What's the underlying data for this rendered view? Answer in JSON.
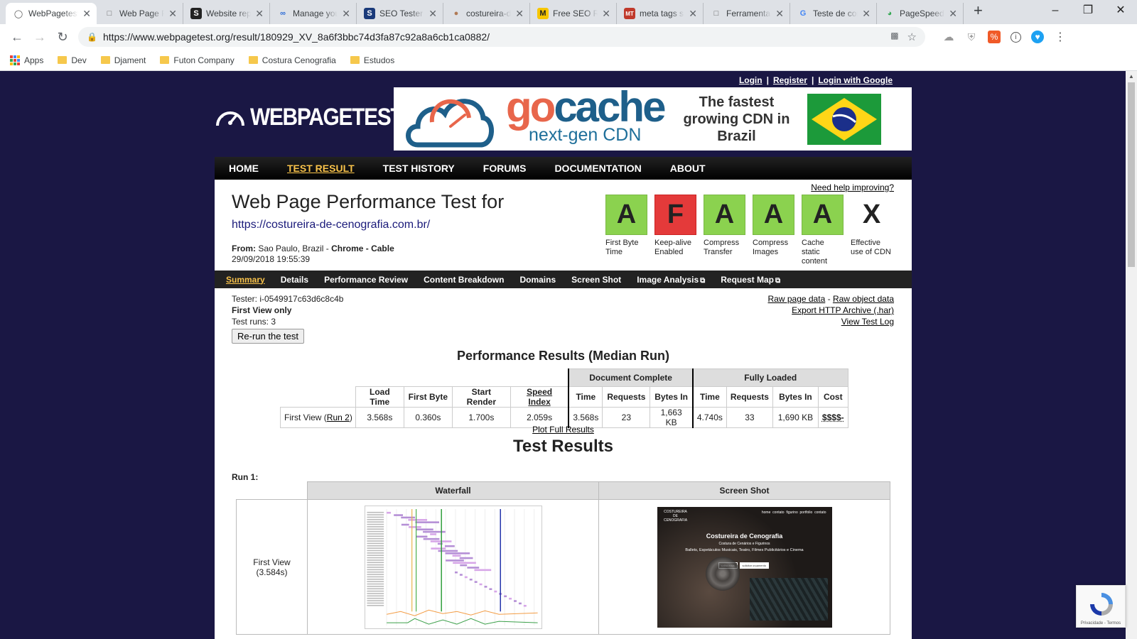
{
  "browser": {
    "tabs": [
      {
        "label": "WebPagetest",
        "icon": "speedometer",
        "active": true
      },
      {
        "label": "Web Page Performance",
        "icon": "page"
      },
      {
        "label": "Website report",
        "icon": "s-logo"
      },
      {
        "label": "Manage your",
        "icon": "infinity"
      },
      {
        "label": "SEO Tester",
        "icon": "seo"
      },
      {
        "label": "costureira-de",
        "icon": "avatar"
      },
      {
        "label": "Free SEO Report",
        "icon": "mo"
      },
      {
        "label": "meta tags seo",
        "icon": "mt"
      },
      {
        "label": "Ferramenta",
        "icon": "page"
      },
      {
        "label": "Teste de compressão",
        "icon": "g-logo"
      },
      {
        "label": "PageSpeed",
        "icon": "pagespeed"
      }
    ],
    "url": "https://www.webpagetest.org/result/180929_XV_8a6f3bbc74d3fa87c92a8a6cb1ca0882/",
    "bookmarks": [
      "Apps",
      "Dev",
      "Djament",
      "Futon Company",
      "Costura Cenografia",
      "Estudos"
    ]
  },
  "account_links": {
    "login": "Login",
    "register": "Register",
    "google": "Login with Google",
    "sep": "|"
  },
  "logo_text": "WEBPAGETEST",
  "banner": {
    "brand_part1": "go",
    "brand_part2": "cache",
    "tagline": "next-gen CDN",
    "slogan": "The fastest growing CDN in Brazil"
  },
  "main_nav": [
    {
      "label": "HOME"
    },
    {
      "label": "TEST RESULT",
      "active": true
    },
    {
      "label": "TEST HISTORY"
    },
    {
      "label": "FORUMS"
    },
    {
      "label": "DOCUMENTATION"
    },
    {
      "label": "ABOUT"
    }
  ],
  "header": {
    "title": "Web Page Performance Test for",
    "url": "https://costureira-de-cenografia.com.br/",
    "from_label": "From:",
    "location": "Sao Paulo, Brazil",
    "browser_conn": "Chrome - Cable",
    "datetime": "29/09/2018 19:55:39",
    "help_link": "Need help improving?"
  },
  "grades": [
    {
      "grade": "A",
      "label": "First Byte Time",
      "status": "good"
    },
    {
      "grade": "F",
      "label": "Keep-alive Enabled",
      "status": "bad"
    },
    {
      "grade": "A",
      "label": "Compress Transfer",
      "status": "good"
    },
    {
      "grade": "A",
      "label": "Compress Images",
      "status": "good"
    },
    {
      "grade": "A",
      "label": "Cache static content",
      "status": "good"
    },
    {
      "grade": "X",
      "label": "Effective use of CDN",
      "status": "none"
    }
  ],
  "sub_nav": [
    {
      "label": "Summary",
      "active": true
    },
    {
      "label": "Details"
    },
    {
      "label": "Performance Review"
    },
    {
      "label": "Content Breakdown"
    },
    {
      "label": "Domains"
    },
    {
      "label": "Screen Shot"
    },
    {
      "label": "Image Analysis",
      "external": true
    },
    {
      "label": "Request Map",
      "external": true
    }
  ],
  "test_info": {
    "tester": "Tester: i-0549917c63d6c8c4b",
    "view": "First View only",
    "runs": "Test runs: 3",
    "rerun_button": "Re-run the test"
  },
  "raw_links": {
    "raw_page": "Raw page data",
    "dash": "-",
    "raw_object": "Raw object data",
    "har": "Export HTTP Archive (.har)",
    "log": "View Test Log"
  },
  "perf_results": {
    "heading": "Performance Results (Median Run)",
    "group_headers": [
      "Document Complete",
      "Fully Loaded"
    ],
    "columns": [
      "Load Time",
      "First Byte",
      "Start Render",
      "Speed Index",
      "Time",
      "Requests",
      "Bytes In",
      "Time",
      "Requests",
      "Bytes In",
      "Cost"
    ],
    "row_label_prefix": "First View (",
    "row_label_link": "Run 2",
    "row_label_suffix": ")",
    "values": [
      "3.568s",
      "0.360s",
      "1.700s",
      "2.059s",
      "3.568s",
      "23",
      "1,663 KB",
      "4.740s",
      "33",
      "1,690 KB",
      "$$$$-"
    ]
  },
  "plot_link": "Plot Full Results",
  "test_results": {
    "heading": "Test Results",
    "run_label": "Run 1:",
    "col_headers": [
      "Waterfall",
      "Screen Shot"
    ],
    "row_label": "First View",
    "row_time": "(3.584s)"
  },
  "screenshot_preview": {
    "site_logo": "COSTUREIRA DE CENOGRAFIA",
    "nav": "home  contato  figurino  portfolio  contato",
    "title": "Costureira de Cenografia",
    "subtitle": "Costura de Cenários e Figurinos",
    "desc": "Ballets, Espetáculos Musicais, Teatro, Filmes Publicitários e Cinema",
    "btn1": "saiba mais",
    "btn2": "solicitar orçamento"
  },
  "colors": {
    "page_bg": "#1a1744",
    "grade_good": "#8bd24f",
    "grade_bad": "#e43a3a",
    "nav_active": "#f8c24a"
  },
  "recaptcha": {
    "footer": "Privacidade - Termos"
  }
}
